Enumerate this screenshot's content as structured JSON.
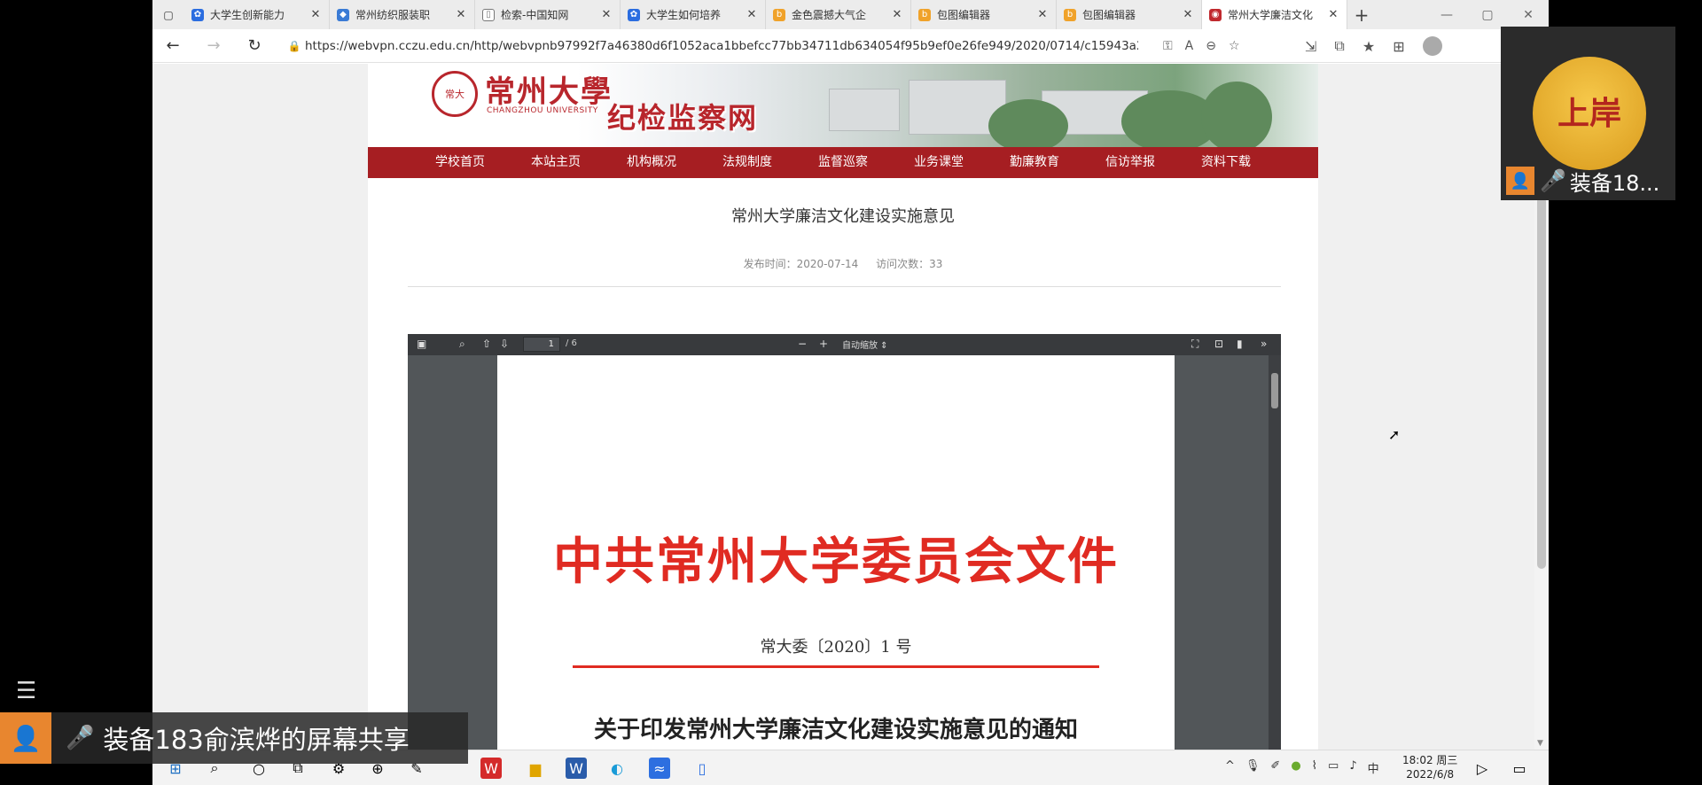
{
  "browser": {
    "tabs": [
      {
        "title": "大学生创新能力",
        "color": "#2b6de0"
      },
      {
        "title": "常州纺织服装职",
        "color": "#3a7bd5"
      },
      {
        "title": "检索-中国知网",
        "color": "#777777"
      },
      {
        "title": "大学生如何培养",
        "color": "#2b6de0"
      },
      {
        "title": "金色震撼大气企",
        "color": "#f0a22a"
      },
      {
        "title": "包图编辑器",
        "color": "#f0a22a"
      },
      {
        "title": "包图编辑器",
        "color": "#f0a22a"
      },
      {
        "title": "常州大学廉洁文化",
        "color": "#c0292e"
      }
    ],
    "url": "https://webvpn.cczu.edu.cn/http/webvpnb97992f7a46380d6f1052aca1bbefcc77bb34711db634054f95b9ef0e26fe949/2020/0714/c15943a233713/..."
  },
  "site": {
    "university_cn": "常州大學",
    "university_en": "CHANGZHOU UNIVERSITY",
    "site_name": "纪检监察网",
    "menu": [
      "学校首页",
      "本站主页",
      "机构概况",
      "法规制度",
      "监督巡察",
      "业务课堂",
      "勤廉教育",
      "信访举报",
      "资料下载"
    ]
  },
  "article": {
    "title": "常州大学廉洁文化建设实施意见",
    "publish_time": "发布时间：2020-07-14",
    "visits": "访问次数：33"
  },
  "pdf": {
    "page_input": "1",
    "page_count": "/ 6",
    "zoom_label": "自动缩放",
    "doc_header": "中共常州大学委员会文件",
    "doc_number": "常大委〔2020〕1 号",
    "notice_title": "关于印发常州大学廉洁文化建设实施意见的通知"
  },
  "taskbar": {
    "ime": "中",
    "time": "18:02 周三",
    "date": "2022/6/8"
  },
  "overlay": {
    "pip_badge": "上岸",
    "pip_name": "装备18...",
    "share_text": "装备183俞滨烨的屏幕共享"
  }
}
